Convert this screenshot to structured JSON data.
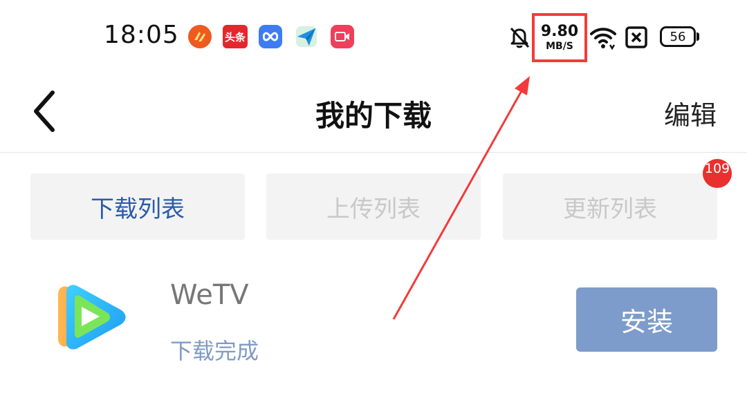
{
  "status_bar": {
    "time": "18:05",
    "app_badge_toutiao": "头条",
    "net_speed_value": "9.80",
    "net_speed_unit": "MB/S",
    "battery": "56"
  },
  "header": {
    "title": "我的下载",
    "edit_label": "编辑"
  },
  "tabs": [
    {
      "label": "下载列表",
      "active": true
    },
    {
      "label": "上传列表",
      "active": false
    },
    {
      "label": "更新列表",
      "active": false
    }
  ],
  "update_badge": "109",
  "download_item": {
    "name": "WeTV",
    "status": "下载完成",
    "action_label": "安装"
  },
  "colors": {
    "accent_blue": "#2b5aa8",
    "install_button": "#7d9ccb",
    "annotation_red": "#f23b3b",
    "badge_red": "#e9302f"
  }
}
